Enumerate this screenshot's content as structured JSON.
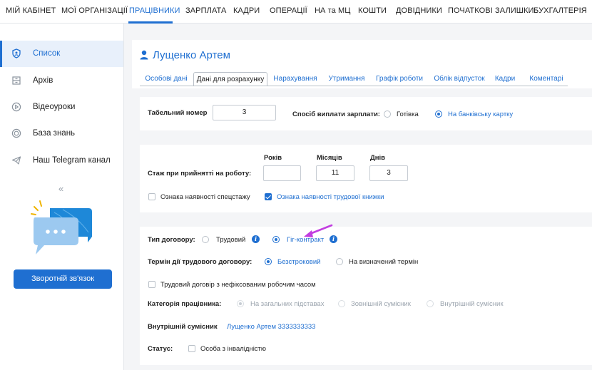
{
  "topnav": {
    "items": [
      "МІЙ КАБІНЕТ",
      "МОЇ ОРГАНІЗАЦІЇ",
      "ПРАЦІВНИКИ",
      "ЗАРПЛАТА",
      "КАДРИ",
      "ОПЕРАЦІЇ",
      "НА та МЦ",
      "КОШТИ",
      "ДОВІДНИКИ",
      "ПОЧАТКОВІ ЗАЛИШКИ",
      "БУХГАЛТЕРІЯ"
    ],
    "active": "ПРАЦІВНИКИ"
  },
  "sidebar": {
    "items": [
      {
        "label": "Список",
        "icon": "shield-icon",
        "active": true
      },
      {
        "label": "Архів",
        "icon": "archive-icon"
      },
      {
        "label": "Відеоуроки",
        "icon": "play-icon"
      },
      {
        "label": "База знань",
        "icon": "globe-icon"
      },
      {
        "label": "Наш Telegram канал",
        "icon": "telegram-icon"
      }
    ],
    "collapse_glyph": "«",
    "feedback_button": "Зворотній зв'язок"
  },
  "employee": {
    "name": "Лущенко Артем"
  },
  "tabs": [
    "Особові дані",
    "Дані для розрахунку",
    "Нарахування",
    "Утримання",
    "Графік роботи",
    "Облік відпусток",
    "Кадри",
    "Коментарі"
  ],
  "active_tab": "Дані для розрахунку",
  "payment": {
    "tab_number_label": "Табельний номер",
    "tab_number_value": "3",
    "method_label": "Спосіб виплати зарплати:",
    "options": [
      "Готівка",
      "На банківську картку"
    ],
    "selected": "На банківську картку"
  },
  "experience": {
    "label": "Стаж при прийнятті на роботу:",
    "years_label": "Років",
    "years_value": "",
    "months_label": "Місяців",
    "months_value": "11",
    "days_label": "Днів",
    "days_value": "3",
    "special_label": "Ознака наявності спецстажу",
    "special_checked": false,
    "workbook_label": "Ознака наявності трудової книжки",
    "workbook_checked": true
  },
  "contract": {
    "type_label": "Тип договору:",
    "type_options": [
      "Трудовий",
      "Гіг-контракт"
    ],
    "type_selected": "Гіг-контракт",
    "term_label": "Термін дії трудового договору:",
    "term_options": [
      "Безстроковий",
      "На визначений термін"
    ],
    "term_selected": "Безстроковий",
    "unfixed_label": "Трудовий договір з нефіксованим робочим часом",
    "unfixed_checked": false,
    "category_label": "Категорія працівника:",
    "category_options": [
      "На загальних підставах",
      "Зовнішній сумісник",
      "Внутрішній сумісник"
    ],
    "category_selected": "На загальних підставах",
    "internal_label": "Внутрішній сумісник",
    "internal_value": "Лущенко Артем 3333333333",
    "status_label": "Статус:",
    "status_option": "Особа з інвалідністю",
    "status_checked": false
  },
  "colors": {
    "accent": "#1f6fd1",
    "arrow": "#c23ee0",
    "background": "#f4f5f7"
  }
}
